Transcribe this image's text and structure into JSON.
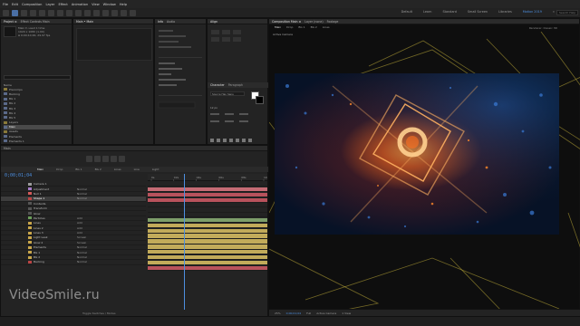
{
  "menu": {
    "items": [
      "File",
      "Edit",
      "Composition",
      "Layer",
      "Effect",
      "Animation",
      "View",
      "Window",
      "Help"
    ]
  },
  "workspaces": {
    "items": [
      "Default",
      "Learn",
      "Standard",
      "Small Screen",
      "Libraries",
      "Motion 2019",
      "»"
    ],
    "selected_index": 5,
    "search_placeholder": "Search Help"
  },
  "project": {
    "tabs": [
      "Project ≡",
      "Effect Controls Main"
    ],
    "item_info": [
      "Main ▾, used 1 time",
      "1920 x 1080 (1.00)",
      "Δ 0;00;10;00, 29.97 fps"
    ],
    "items": [
      "Name",
      "Precomps",
      "Backing",
      "BG 1",
      "BG 2",
      "BG 3",
      "BG 4",
      "BG 5",
      "Layers",
      "Main",
      "Assets",
      "Elements",
      "Elements 1",
      "Elements 2",
      "Solids",
      "Null"
    ],
    "selected_index": 9
  },
  "effect_controls": {
    "title": "Main • Main"
  },
  "properties": {
    "tabs": [
      "Info",
      "Audio",
      "Paragraph"
    ]
  },
  "align_panel": {
    "title": "Align",
    "tabs": [
      "Character",
      "Paragraph"
    ],
    "font": "Source Han Sans",
    "size_label": "12 px"
  },
  "timeline": {
    "tabs": [
      "Main",
      "Drop",
      "BG 1",
      "BG 2",
      "Lines",
      "Line",
      "Light"
    ],
    "selected_tab": 0,
    "timecode": "0;00;01;04",
    "ruler_labels": [
      "0s",
      "02s",
      "04s",
      "06s",
      "08s",
      "10s"
    ],
    "layers": [
      {
        "name": "Camera 1",
        "mode": "",
        "color": "#9b9b9b"
      },
      {
        "name": "Adjustment",
        "mode": "Normal",
        "color": "#a67cc9"
      },
      {
        "name": "Null 1",
        "mode": "Normal",
        "color": "#d35a5a"
      },
      {
        "name": "Shape 1",
        "mode": "Normal",
        "color": "#b44"
      },
      {
        "name": "Contents",
        "mode": "",
        "color": "#555"
      },
      {
        "name": "Transform",
        "mode": "",
        "color": "#555"
      },
      {
        "name": "Glow",
        "mode": "",
        "color": "#555"
      },
      {
        "name": "Particles",
        "mode": "Add",
        "color": "#6b9e5a"
      },
      {
        "name": "Lines",
        "mode": "Add",
        "color": "#c9a64a"
      },
      {
        "name": "Lines 2",
        "mode": "Add",
        "color": "#c9a64a"
      },
      {
        "name": "Lines 3",
        "mode": "Add",
        "color": "#c9a64a"
      },
      {
        "name": "Light Leak",
        "mode": "Screen",
        "color": "#c9a64a"
      },
      {
        "name": "Glow 2",
        "mode": "Screen",
        "color": "#c9a64a"
      },
      {
        "name": "Elements",
        "mode": "Normal",
        "color": "#c9a64a"
      },
      {
        "name": "BG 1",
        "mode": "Normal",
        "color": "#c9a64a"
      },
      {
        "name": "BG 2",
        "mode": "Normal",
        "color": "#c9a64a"
      },
      {
        "name": "Backing",
        "mode": "Normal",
        "color": "#b44"
      }
    ],
    "selected_layer": 3,
    "footer": "Toggle Switches / Modes"
  },
  "viewer": {
    "tabs": [
      "Composition Main ≡",
      "Layer (none)",
      "Footage"
    ],
    "sub_tabs": [
      "Main",
      "Drop",
      "BG 1",
      "BG 2",
      "Lines"
    ],
    "renderer": "Renderer: Classic 3D",
    "view_label": "Active Camera",
    "bottom": [
      "25%",
      "0;00;01;04",
      "Full",
      "Active Camera",
      "1 View"
    ]
  },
  "watermark": "VideoSmile.ru",
  "colors": {
    "accent_blue": "#4d8fe0",
    "track_red": "#b8525c",
    "track_pink": "#c56b74",
    "track_yellow": "#c2ab5a",
    "track_green": "#7d9e6a"
  }
}
